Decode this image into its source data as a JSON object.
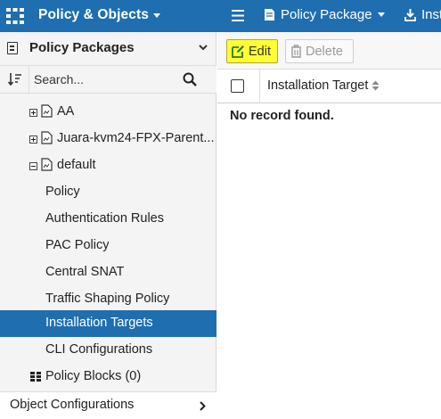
{
  "topbar": {
    "app_title": "Policy & Objects",
    "policy_package_menu": "Policy Package",
    "install_menu": "Insta",
    "icons": {
      "apps": "grid-icon",
      "menu": "hamburger-icon",
      "package": "package-icon",
      "install": "install-icon"
    },
    "background_color": "#1f6eb0"
  },
  "left_panel": {
    "header_title": "Policy Packages",
    "search": {
      "placeholder": "Search...",
      "value": ""
    },
    "tree": [
      {
        "label": "AA",
        "type": "package",
        "expanded": false
      },
      {
        "label": "Juara-kvm24-FPX-Parent...",
        "type": "package",
        "expanded": false
      },
      {
        "label": "default",
        "type": "package",
        "expanded": true
      },
      {
        "label": "Policy",
        "type": "child"
      },
      {
        "label": "Authentication Rules",
        "type": "child"
      },
      {
        "label": "PAC Policy",
        "type": "child"
      },
      {
        "label": "Central SNAT",
        "type": "child"
      },
      {
        "label": "Traffic Shaping Policy",
        "type": "child"
      },
      {
        "label": "Installation Targets",
        "type": "child",
        "selected": true
      },
      {
        "label": "CLI Configurations",
        "type": "child"
      },
      {
        "label": "Policy Blocks (0)",
        "type": "blocks"
      }
    ],
    "footer": "Object Configurations",
    "selected_color": "#1f6eb0"
  },
  "main": {
    "toolbar": {
      "edit_label": "Edit",
      "delete_label": "Delete",
      "edit_highlight_color": "#ffff33"
    },
    "table": {
      "columns": [
        "Installation Target"
      ],
      "empty_message": "No record found."
    }
  }
}
